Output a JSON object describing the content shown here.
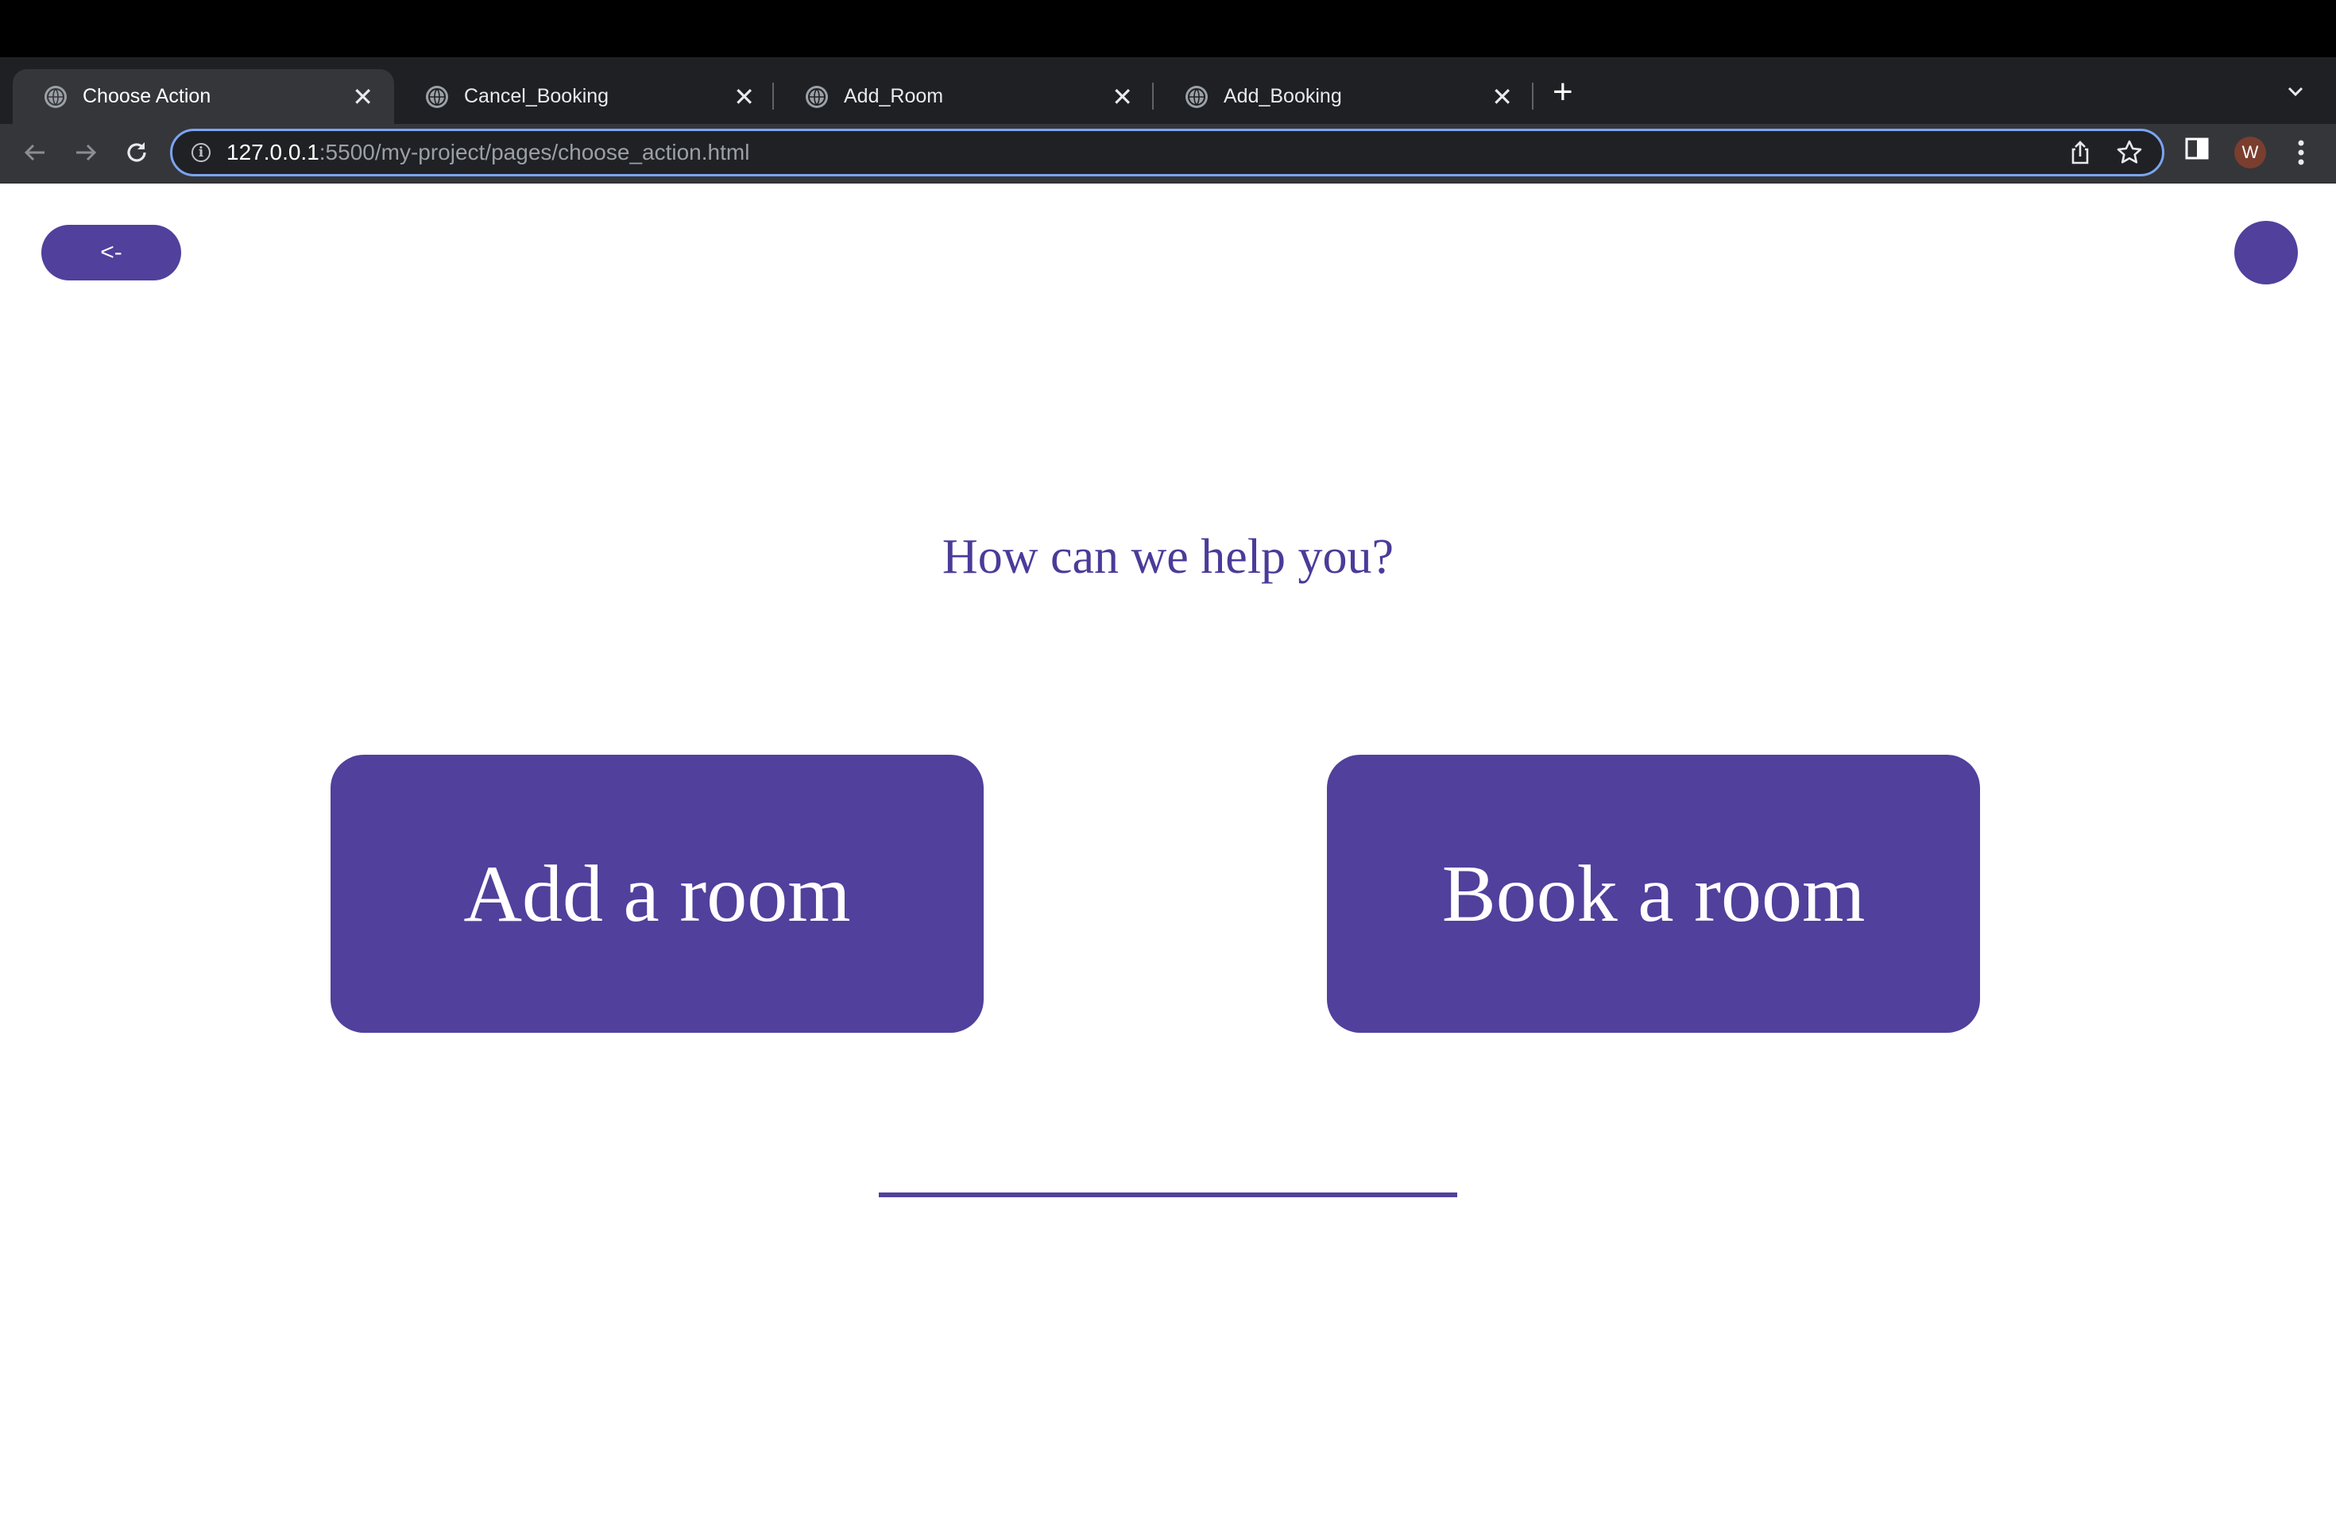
{
  "browser": {
    "tabs": [
      {
        "label": "Choose Action",
        "active": true
      },
      {
        "label": "Cancel_Booking",
        "active": false
      },
      {
        "label": "Add_Room",
        "active": false
      },
      {
        "label": "Add_Booking",
        "active": false
      }
    ],
    "new_tab_label": "+",
    "tab_close": "✕",
    "address": {
      "host": "127.0.0.1",
      "path": ":5500/my-project/pages/choose_action.html"
    },
    "profile_initial": "W",
    "icons": [
      "globe-icon",
      "close-icon",
      "plus-icon",
      "chevron-down-icon",
      "back-arrow-icon",
      "forward-arrow-icon",
      "reload-icon",
      "info-icon",
      "share-icon",
      "star-icon",
      "side-panel-icon",
      "kebab-menu-icon"
    ]
  },
  "page": {
    "back_button_label": "<-",
    "heading": "How can we help you?",
    "actions": [
      {
        "label": "Add a room"
      },
      {
        "label": "Book a room"
      }
    ],
    "accent_color": "#51409c"
  }
}
